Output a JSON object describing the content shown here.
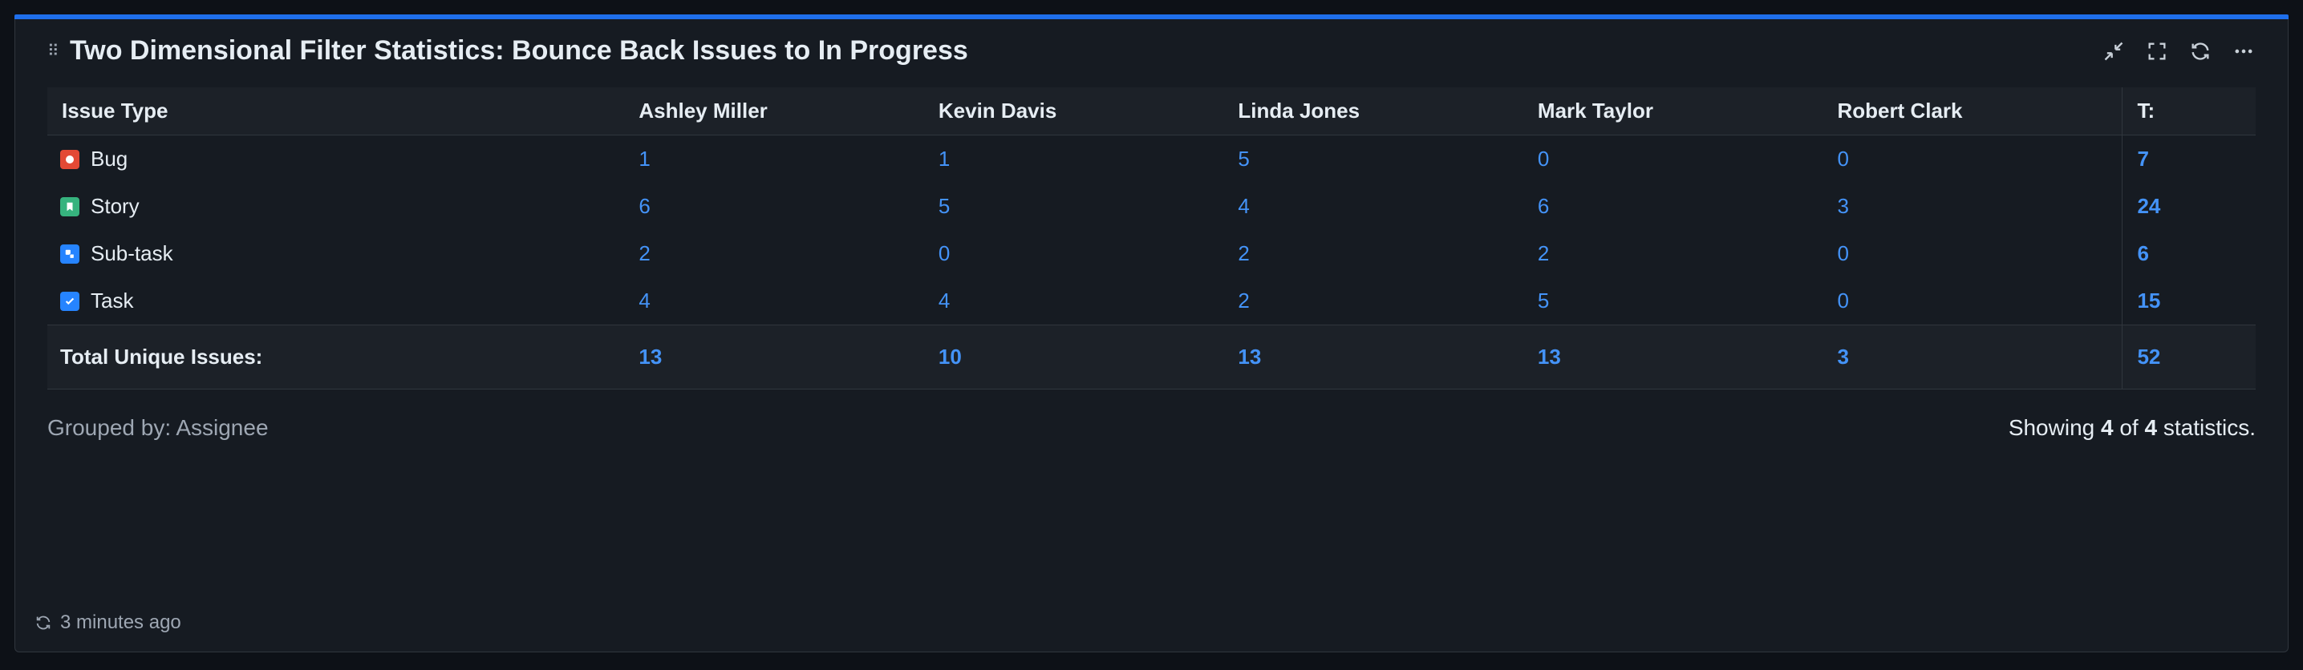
{
  "panel": {
    "title": "Two Dimensional Filter Statistics: Bounce Back Issues to In Progress"
  },
  "table": {
    "header_first": "Issue Type",
    "assignees": [
      "Ashley Miller",
      "Kevin Davis",
      "Linda Jones",
      "Mark Taylor",
      "Robert Clark"
    ],
    "header_total": "T:",
    "rows": [
      {
        "icon": "bug",
        "label": "Bug",
        "vals": [
          "1",
          "1",
          "5",
          "0",
          "0"
        ],
        "total": "7"
      },
      {
        "icon": "story",
        "label": "Story",
        "vals": [
          "6",
          "5",
          "4",
          "6",
          "3"
        ],
        "total": "24"
      },
      {
        "icon": "subtask",
        "label": "Sub-task",
        "vals": [
          "2",
          "0",
          "2",
          "2",
          "0"
        ],
        "total": "6"
      },
      {
        "icon": "task",
        "label": "Task",
        "vals": [
          "4",
          "4",
          "2",
          "5",
          "0"
        ],
        "total": "15"
      }
    ],
    "total_label": "Total Unique Issues:",
    "totals": [
      "13",
      "10",
      "13",
      "13",
      "3"
    ],
    "grand_total": "52"
  },
  "footer": {
    "grouped_by": "Grouped by: Assignee",
    "showing_pre": "Showing ",
    "showing_n": "4",
    "showing_mid": " of ",
    "showing_total": "4",
    "showing_post": " statistics."
  },
  "updated": {
    "text": "3 minutes ago"
  },
  "chart_data": {
    "type": "table",
    "title": "Two Dimensional Filter Statistics: Bounce Back Issues to In Progress",
    "row_labels": [
      "Bug",
      "Story",
      "Sub-task",
      "Task"
    ],
    "col_labels": [
      "Ashley Miller",
      "Kevin Davis",
      "Linda Jones",
      "Mark Taylor",
      "Robert Clark"
    ],
    "values": [
      [
        1,
        1,
        5,
        0,
        0
      ],
      [
        6,
        5,
        4,
        6,
        3
      ],
      [
        2,
        0,
        2,
        2,
        0
      ],
      [
        4,
        4,
        2,
        5,
        0
      ]
    ],
    "row_totals": [
      7,
      24,
      6,
      15
    ],
    "col_totals": [
      13,
      10,
      13,
      13,
      3
    ],
    "grand_total": 52
  }
}
